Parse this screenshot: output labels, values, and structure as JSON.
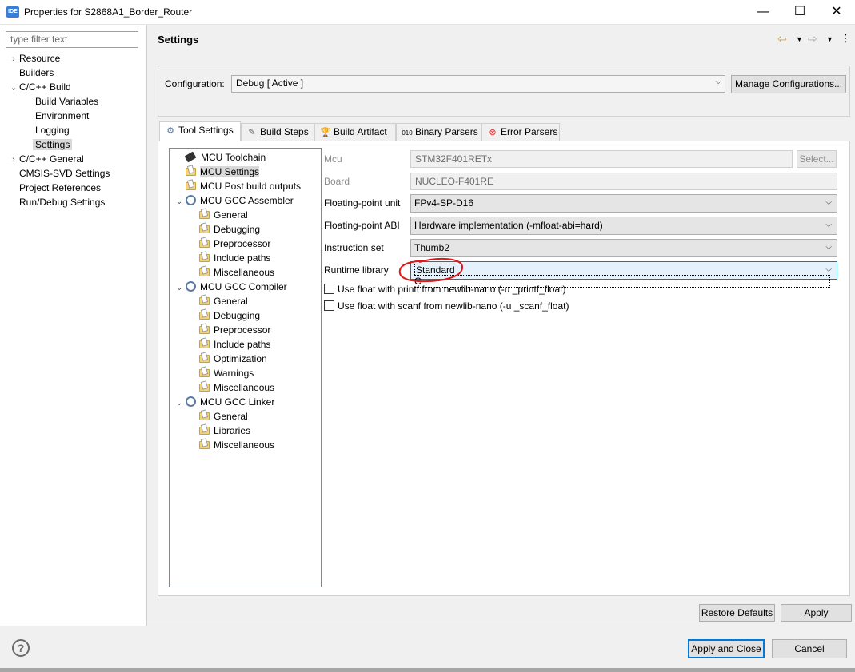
{
  "window": {
    "app_icon": "IDE",
    "title": "Properties for S2868A1_Border_Router",
    "minimize": "—",
    "maximize": "☐",
    "close": "✕"
  },
  "filter": {
    "placeholder": "type filter text"
  },
  "nav": [
    {
      "label": "Resource",
      "chevron": "›",
      "level": 0
    },
    {
      "label": "Builders",
      "chevron": "",
      "level": 0
    },
    {
      "label": "C/C++ Build",
      "chevron": "⌄",
      "level": 0
    },
    {
      "label": "Build Variables",
      "chevron": "",
      "level": 1
    },
    {
      "label": "Environment",
      "chevron": "",
      "level": 1
    },
    {
      "label": "Logging",
      "chevron": "",
      "level": 1
    },
    {
      "label": "Settings",
      "chevron": "",
      "level": 1,
      "selected": true
    },
    {
      "label": "C/C++ General",
      "chevron": "›",
      "level": 0
    },
    {
      "label": "CMSIS-SVD Settings",
      "chevron": "",
      "level": 0
    },
    {
      "label": "Project References",
      "chevron": "",
      "level": 0
    },
    {
      "label": "Run/Debug Settings",
      "chevron": "",
      "level": 0
    }
  ],
  "page_title": "Settings",
  "configuration": {
    "label": "Configuration:",
    "value": "Debug  [ Active ]",
    "manage_label": "Manage Configurations..."
  },
  "tabs": [
    {
      "label": "Tool Settings",
      "icon": "tool-settings-icon",
      "active": true
    },
    {
      "label": "Build Steps",
      "icon": "build-steps-icon"
    },
    {
      "label": "Build Artifact",
      "icon": "build-artifact-icon"
    },
    {
      "label": "Binary Parsers",
      "icon": "binary-parsers-icon"
    },
    {
      "label": "Error Parsers",
      "icon": "error-parsers-icon"
    }
  ],
  "tool_tree": [
    {
      "label": "MCU Toolchain",
      "icon": "chip-icon",
      "level": 0
    },
    {
      "label": "MCU Settings",
      "icon": "folder-icon",
      "level": 0,
      "selected": true
    },
    {
      "label": "MCU Post build outputs",
      "icon": "folder-icon",
      "level": 0
    },
    {
      "label": "MCU GCC Assembler",
      "icon": "gear-icon",
      "level": 0,
      "expanded": true
    },
    {
      "label": "General",
      "icon": "folder-icon",
      "level": 1
    },
    {
      "label": "Debugging",
      "icon": "folder-icon",
      "level": 1
    },
    {
      "label": "Preprocessor",
      "icon": "folder-icon",
      "level": 1
    },
    {
      "label": "Include paths",
      "icon": "folder-icon",
      "level": 1
    },
    {
      "label": "Miscellaneous",
      "icon": "folder-icon",
      "level": 1
    },
    {
      "label": "MCU GCC Compiler",
      "icon": "gear-icon",
      "level": 0,
      "expanded": true
    },
    {
      "label": "General",
      "icon": "folder-icon",
      "level": 1
    },
    {
      "label": "Debugging",
      "icon": "folder-icon",
      "level": 1
    },
    {
      "label": "Preprocessor",
      "icon": "folder-icon",
      "level": 1
    },
    {
      "label": "Include paths",
      "icon": "folder-icon",
      "level": 1
    },
    {
      "label": "Optimization",
      "icon": "folder-icon",
      "level": 1
    },
    {
      "label": "Warnings",
      "icon": "folder-icon",
      "level": 1
    },
    {
      "label": "Miscellaneous",
      "icon": "folder-icon",
      "level": 1
    },
    {
      "label": "MCU GCC Linker",
      "icon": "gear-icon",
      "level": 0,
      "expanded": true
    },
    {
      "label": "General",
      "icon": "folder-icon",
      "level": 1
    },
    {
      "label": "Libraries",
      "icon": "folder-icon",
      "level": 1
    },
    {
      "label": "Miscellaneous",
      "icon": "folder-icon",
      "level": 1
    }
  ],
  "fields": {
    "mcu": {
      "label": "Mcu",
      "value": "STM32F401RETx",
      "select_label": "Select..."
    },
    "board": {
      "label": "Board",
      "value": "NUCLEO-F401RE"
    },
    "fpu": {
      "label": "Floating-point unit",
      "value": "FPv4-SP-D16"
    },
    "fpabi": {
      "label": "Floating-point ABI",
      "value": "Hardware implementation (-mfloat-abi=hard)"
    },
    "iset": {
      "label": "Instruction set",
      "value": "Thumb2"
    },
    "runtime": {
      "label": "Runtime library",
      "value": "Standard C"
    },
    "printf_float": {
      "label": "Use float with printf from newlib-nano (-u _printf_float)",
      "checked": false
    },
    "scanf_float": {
      "label": "Use float with scanf from newlib-nano (-u _scanf_float)",
      "checked": false
    }
  },
  "buttons": {
    "restore_defaults": "Restore Defaults",
    "apply": "Apply",
    "apply_close": "Apply and Close",
    "cancel": "Cancel"
  },
  "help": "?",
  "colors": {
    "annotation": "#e01818",
    "default_button_border": "#0078d7"
  }
}
